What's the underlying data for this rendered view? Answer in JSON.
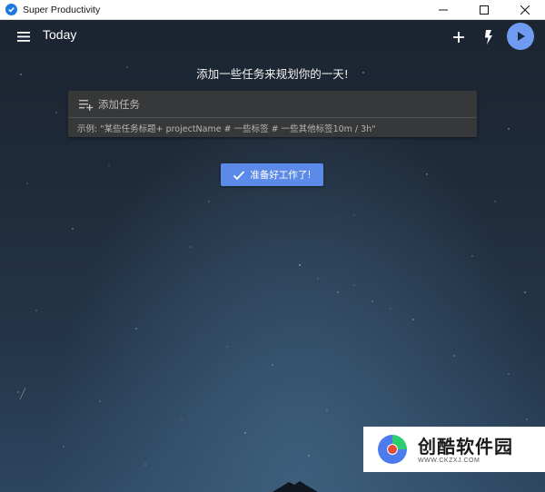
{
  "window": {
    "title": "Super Productivity",
    "controls": [
      "minimize",
      "maximize",
      "close"
    ]
  },
  "header": {
    "title": "Today",
    "menu_icon": "menu-icon",
    "add_icon": "plus-icon",
    "flash_icon": "lightning-icon",
    "play_icon": "play-icon"
  },
  "main": {
    "prompt": "添加一些任务来规划你的一天!",
    "add_task": {
      "placeholder": "添加任务",
      "hint": "示例: \"某些任务标题+ projectName # 一些标签 # 一些其他标签10m / 3h\""
    },
    "ready_button": "准备好工作了!"
  },
  "watermark": {
    "name": "创酷软件园",
    "url": "WWW.CKZXJ.COM"
  },
  "colors": {
    "accent": "#5b8ae8",
    "play_button": "#6f9cf0",
    "background_top": "#1c2430",
    "background_bottom": "#2d4660",
    "card": "#3a3a3a"
  }
}
